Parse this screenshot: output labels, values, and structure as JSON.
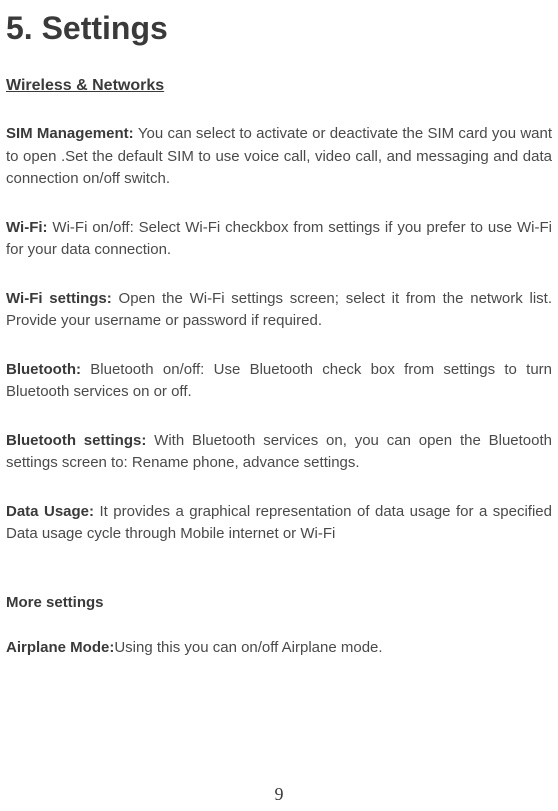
{
  "heading": "5. Settings",
  "subheading": "Wireless & Networks",
  "paragraphs": [
    {
      "label": "SIM Management: ",
      "text": "You can select to activate or deactivate the SIM card you want to open .Set the default SIM to use voice call, video call, and messaging and data connection on/off switch."
    },
    {
      "label": "Wi-Fi: ",
      "text": "Wi-Fi on/off: Select Wi-Fi checkbox from settings if you prefer to use Wi-Fi for your data connection."
    },
    {
      "label": "Wi-Fi settings: ",
      "text": "Open the Wi-Fi settings screen; select it from the network list. Provide your username or password if required."
    },
    {
      "label": "Bluetooth: ",
      "text": "Bluetooth on/off: Use Bluetooth check box from settings to turn Bluetooth services on or off."
    },
    {
      "label": "Bluetooth settings: ",
      "text": "With Bluetooth services on, you can open the Bluetooth settings screen to: Rename phone, advance settings."
    },
    {
      "label": "Data Usage: ",
      "text": "It provides a graphical representation of data usage for a specified Data usage cycle through Mobile internet or Wi-Fi"
    }
  ],
  "subheading2": "More settings",
  "paragraph2": {
    "label": "Airplane Mode:",
    "text": "Using this you can on/off Airplane mode."
  },
  "page_number": "9"
}
